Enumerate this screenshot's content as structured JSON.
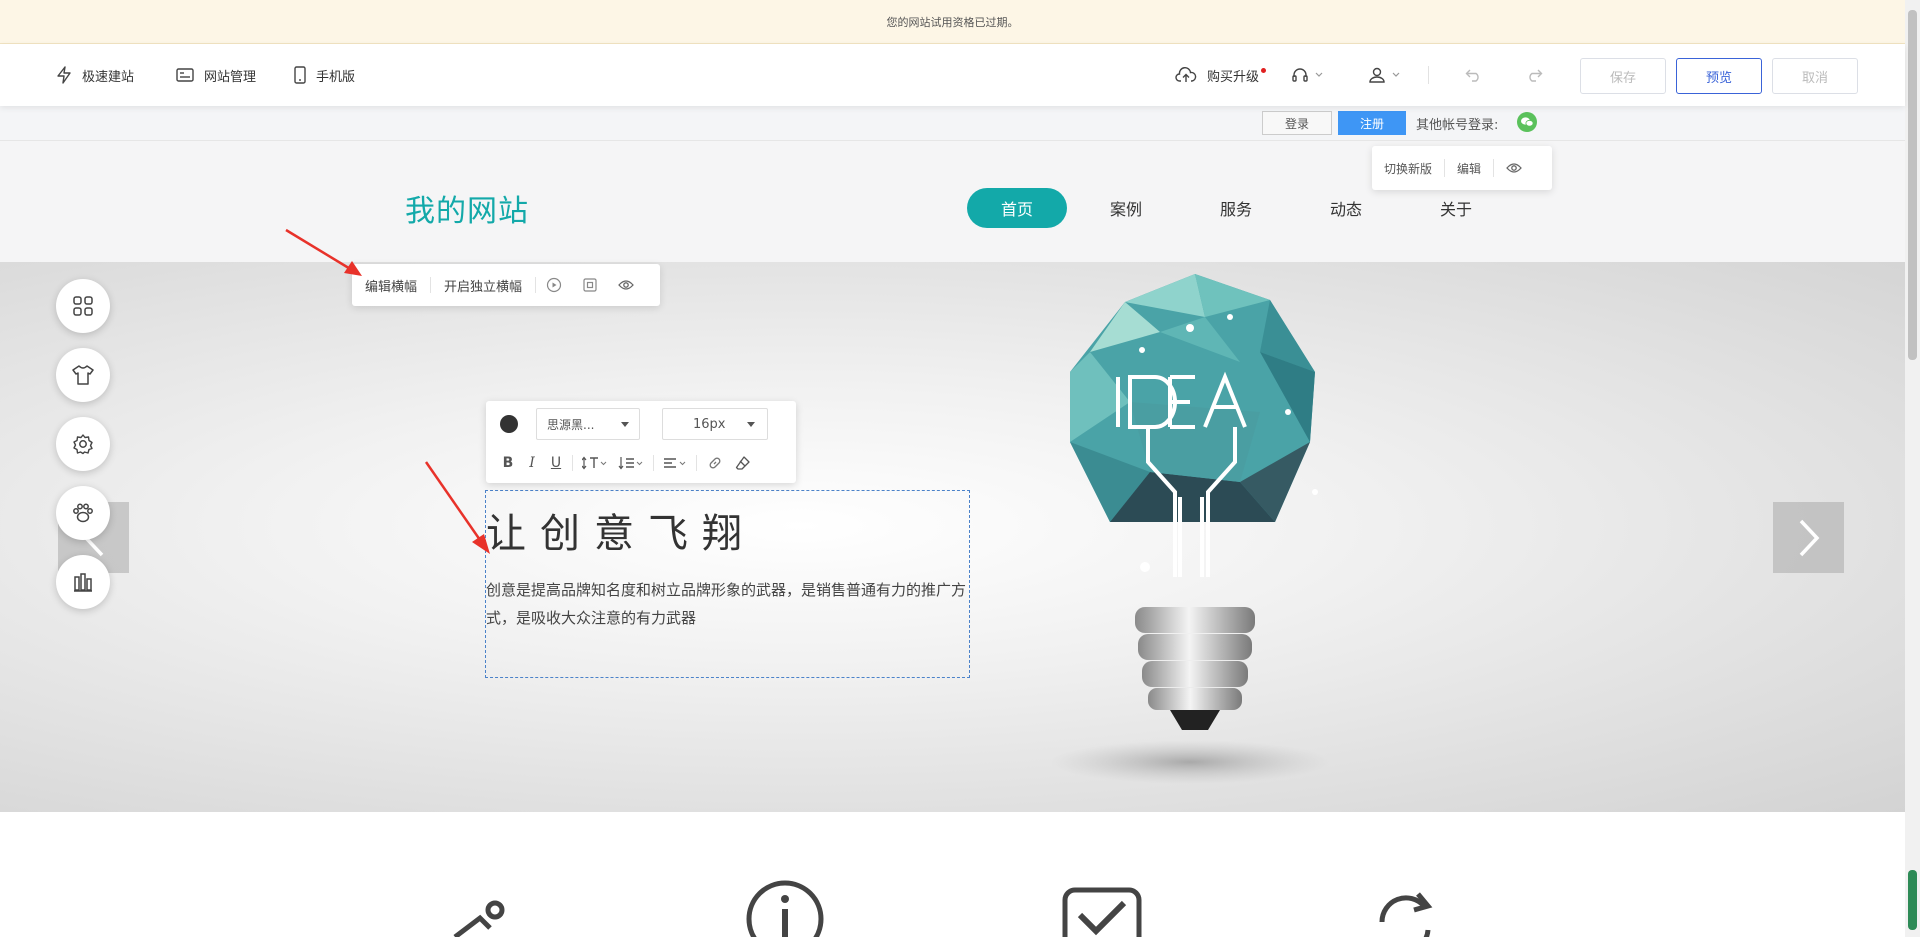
{
  "notice": "您的网站试用资格已过期。",
  "toolbar": {
    "quick_build": "极速建站",
    "site_manage": "网站管理",
    "mobile": "手机版",
    "buy_upgrade": "购买升级",
    "save": "保存",
    "preview": "预览",
    "cancel": "取消"
  },
  "account": {
    "login": "登录",
    "register": "注册",
    "other_login": "其他帐号登录:"
  },
  "edit_popup": {
    "switch_new": "切换新版",
    "edit": "编辑"
  },
  "site": {
    "logo": "我的网站",
    "nav": [
      "首页",
      "案例",
      "服务",
      "动态",
      "关于"
    ]
  },
  "banner_bar": {
    "edit_banner": "编辑横幅",
    "independent_banner": "开启独立横幅"
  },
  "format_bar": {
    "font": "思源黑...",
    "size": "16px"
  },
  "banner": {
    "headline": "让创意飞翔",
    "paragraph": "创意是提高品牌知名度和树立品牌形象的武器，是销售普通有力的推广方式，是吸收大众注意的有力武器"
  },
  "colors": {
    "accent": "#13a9a9",
    "primary_blue": "#3a63d8",
    "register_blue": "#3e96f5",
    "arrow_red": "#e8322a",
    "wechat_green": "#5ac15b"
  }
}
